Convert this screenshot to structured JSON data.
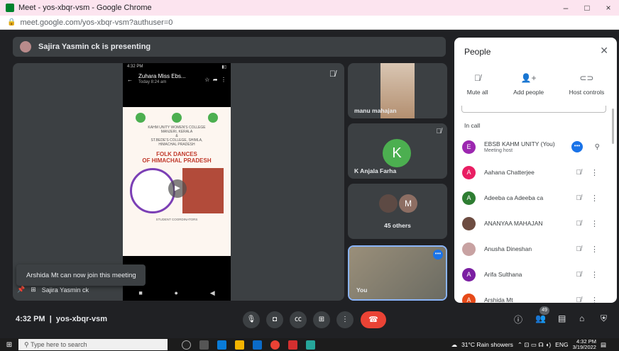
{
  "browser": {
    "title": "Meet - yos-xbqr-vsm - Google Chrome",
    "url": "meet.google.com/yos-xbqr-vsm?authuser=0",
    "window_controls": [
      "–",
      "□",
      "×"
    ]
  },
  "banner": {
    "text": "Sajira Yasmin ck is presenting"
  },
  "presentation": {
    "status_time": "4:32 PM",
    "chat_name": "Zuhara Miss Ebs...",
    "chat_sub": "Today 8:24 am",
    "poster": {
      "line1": "KAHM UNITY WOMEN'S COLLEGE",
      "line2": "MANJERI, KERALA",
      "line3": "&",
      "line4": "ST.BEDE'S COLLEGE, SHIMLA,",
      "line5": "HIMACHAL PRADESH",
      "title1": "FOLK DANCES",
      "title2": "OF HIMACHAL PRADESH",
      "footer": "STUDENT COORDINATORS"
    },
    "presenter_label": "Sajira Yasmin ck"
  },
  "toast": {
    "text": "Arshida Mt can now join this meeting"
  },
  "tiles": [
    {
      "name": "manu mahajan"
    },
    {
      "name": "K Anjala Farha",
      "initial": "K"
    },
    {
      "name": "45 others",
      "initial": "M"
    },
    {
      "name": "You"
    }
  ],
  "people_panel": {
    "title": "People",
    "actions": [
      {
        "label": "Mute all",
        "icon": "mic-off-icon"
      },
      {
        "label": "Add people",
        "icon": "add-person-icon"
      },
      {
        "label": "Host controls",
        "icon": "toggle-icon"
      }
    ],
    "section": "In call",
    "participants": [
      {
        "name": "EBSB KAHM UNITY (You)",
        "sub": "Meeting host",
        "initial": "E",
        "color": "#9c27b0"
      },
      {
        "name": "Aahana Chatterjee",
        "initial": "A",
        "color": "#e91e63"
      },
      {
        "name": "Adeeba ca Adeeba ca",
        "initial": "A",
        "color": "#2e7d32"
      },
      {
        "name": "ANANYAA MAHAJAN",
        "initial": "",
        "color": "#6d4c41"
      },
      {
        "name": "Anusha Dineshan",
        "initial": "",
        "color": "#c8a2a2"
      },
      {
        "name": "Arifa Sulthana",
        "initial": "A",
        "color": "#7b1fa2"
      },
      {
        "name": "Arshida Mt",
        "initial": "A",
        "color": "#e64a19"
      }
    ]
  },
  "bottom_bar": {
    "time": "4:32 PM",
    "separator": "|",
    "meeting_code": "yos-xbqr-vsm",
    "participant_count": "49"
  },
  "taskbar": {
    "search_placeholder": "Type here to search",
    "weather": "31°C  Rain showers",
    "lang": "ENG",
    "time": "4:32 PM",
    "date": "3/19/2022"
  }
}
